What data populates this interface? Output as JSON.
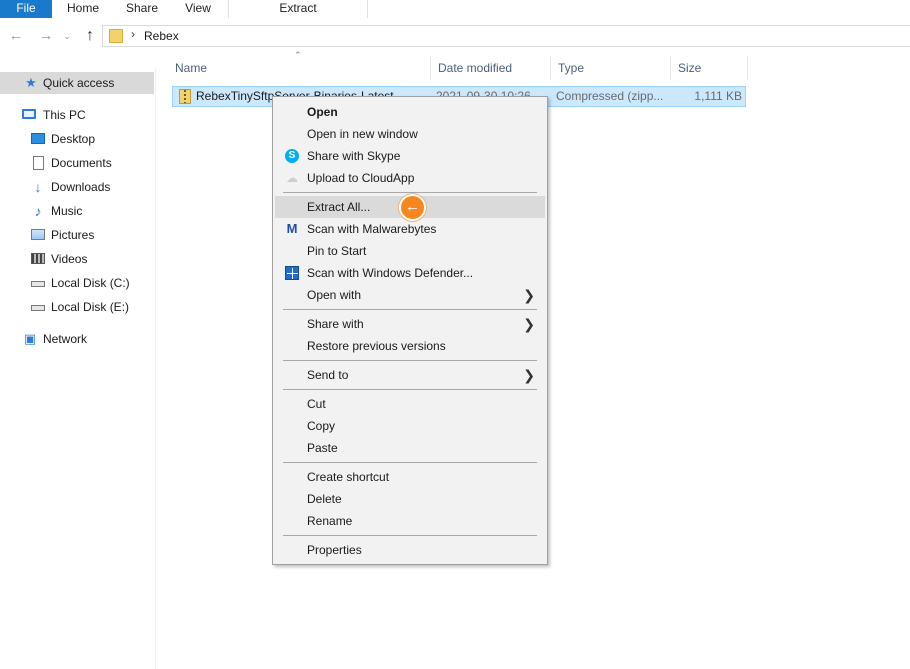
{
  "ribbon": {
    "tabs": [
      "File",
      "Home",
      "Share",
      "View"
    ],
    "contextual_tab": "Extract"
  },
  "nav": {
    "back_icon": "arrow-left",
    "forward_icon": "arrow-right",
    "recent_icon": "chevron-down",
    "up_icon": "arrow-up",
    "breadcrumb": "Rebex"
  },
  "sidebar": {
    "items": [
      {
        "label": "Quick access",
        "icon": "star-icon",
        "active": true
      },
      {
        "label": "This PC",
        "icon": "computer-icon"
      },
      {
        "label": "Desktop",
        "icon": "desktop-icon"
      },
      {
        "label": "Documents",
        "icon": "documents-icon"
      },
      {
        "label": "Downloads",
        "icon": "downloads-icon"
      },
      {
        "label": "Music",
        "icon": "music-icon"
      },
      {
        "label": "Pictures",
        "icon": "pictures-icon"
      },
      {
        "label": "Videos",
        "icon": "videos-icon"
      },
      {
        "label": "Local Disk (C:)",
        "icon": "disk-icon"
      },
      {
        "label": "Local Disk (E:)",
        "icon": "disk-icon"
      },
      {
        "label": "Network",
        "icon": "network-icon"
      }
    ]
  },
  "filelist": {
    "columns": {
      "name": "Name",
      "date": "Date modified",
      "type": "Type",
      "size": "Size"
    },
    "rows": [
      {
        "name": "RebexTinySftpServer-Binaries-Latest",
        "date": "2021-09-30 10:26",
        "type": "Compressed (zipp...",
        "size": "1,111 KB"
      }
    ]
  },
  "context_menu": {
    "items": {
      "open": "Open",
      "open_new_window": "Open in new window",
      "share_skype": "Share with Skype",
      "upload_cloudapp": "Upload to CloudApp",
      "extract_all": "Extract All...",
      "scan_malwarebytes": "Scan with Malwarebytes",
      "pin_start": "Pin to Start",
      "scan_defender": "Scan with Windows Defender...",
      "open_with": "Open with",
      "share_with": "Share with",
      "restore_versions": "Restore previous versions",
      "send_to": "Send to",
      "cut": "Cut",
      "copy": "Copy",
      "paste": "Paste",
      "create_shortcut": "Create shortcut",
      "delete": "Delete",
      "rename": "Rename",
      "properties": "Properties"
    },
    "highlighted": "Extract All..."
  },
  "colors": {
    "accent": "#1979ca",
    "selection": "#cce8ff",
    "pointer": "#f7861e"
  }
}
